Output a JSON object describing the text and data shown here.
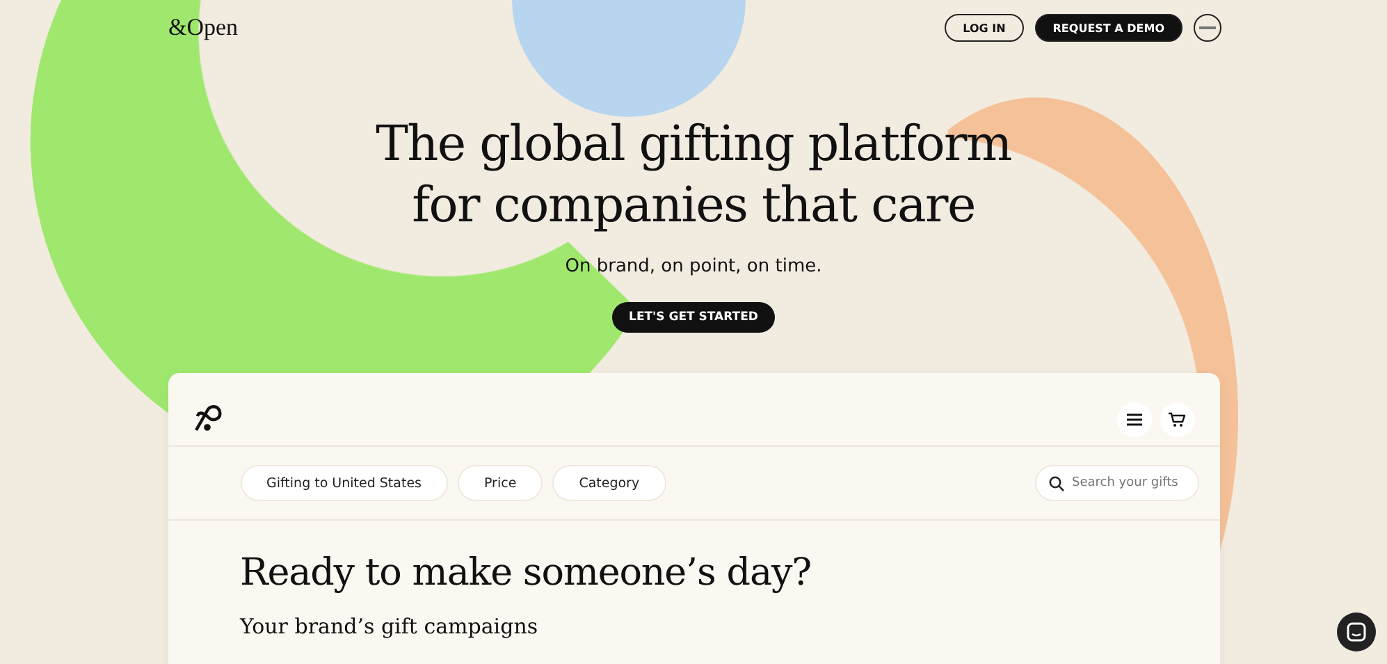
{
  "header": {
    "logo": "&Open",
    "login": "LOG IN",
    "demo": "REQUEST A DEMO"
  },
  "hero": {
    "title_lines": [
      "The global gifting platform",
      "for companies that care"
    ],
    "subtitle": "On brand, on point, on time.",
    "cta": "LET'S GET STARTED"
  },
  "app": {
    "filters": [
      {
        "label": "Gifting to United States"
      },
      {
        "label": "Price"
      },
      {
        "label": "Category"
      }
    ],
    "search": {
      "placeholder": "Search your gifts"
    },
    "heading": "Ready to make someone’s day?",
    "subheading": "Your brand’s gift campaigns"
  }
}
